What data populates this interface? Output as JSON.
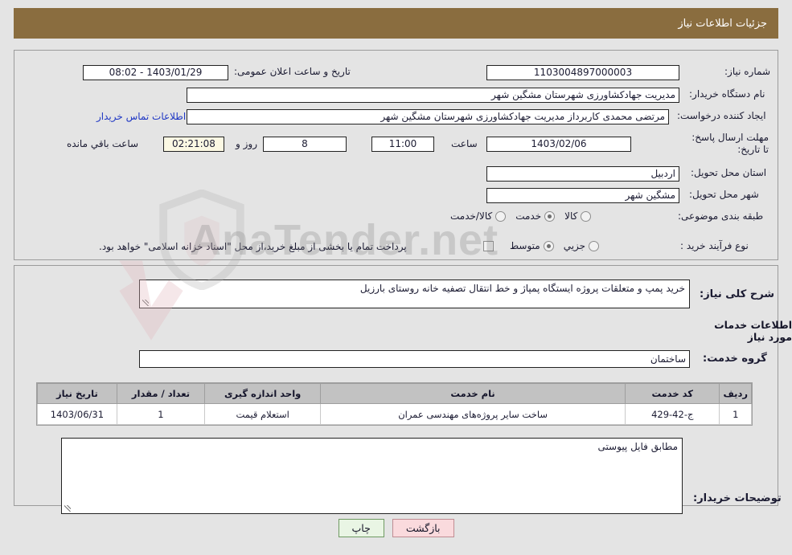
{
  "header": {
    "title": "جزئیات اطلاعات نیاز",
    "bg": "#8a6d3f"
  },
  "watermark": {
    "text": "AnaTender.net"
  },
  "top": {
    "need_number_label": "شماره نیاز:",
    "need_number_value": "1103004897000003",
    "announce_label": "تاریخ و ساعت اعلان عمومی:",
    "announce_value": "1403/01/29 - 08:02",
    "buyer_org_label": "نام دستگاه خریدار:",
    "buyer_org_value": "مدیریت جهادکشاورزی شهرستان مشگین شهر",
    "creator_label": "ایجاد کننده درخواست:",
    "creator_value": "مرتضی محمدی کاربرداز مدیریت جهادکشاورزی شهرستان مشگین شهر",
    "contact_link": "اطلاعات تماس خریدار",
    "deadline_label": "مهلت ارسال پاسخ: تا تاریخ:",
    "deadline_date": "1403/02/06",
    "deadline_hour_label": "ساعت",
    "deadline_hour": "11:00",
    "days_remaining": "8",
    "days_label": "روز و",
    "time_remaining": "02:21:08",
    "remaining_suffix": "ساعت باقي مانده",
    "province_label": "استان محل تحویل:",
    "province_value": "اردبیل",
    "city_label": "شهر محل تحویل:",
    "city_value": "مشگین شهر",
    "category_label": "طبقه بندی موضوعی:",
    "category_options": [
      {
        "label": "کالا",
        "selected": false
      },
      {
        "label": "خدمت",
        "selected": true
      },
      {
        "label": "کالا/خدمت",
        "selected": false
      }
    ],
    "process_label": "نوع فرآیند خرید :",
    "process_options": [
      {
        "label": "جزیي",
        "selected": false
      },
      {
        "label": "متوسط",
        "selected": true
      }
    ],
    "treasury_checkbox_label": "پرداخت تمام یا بخشی از مبلغ خرید،از محل \"اسناد خزانه اسلامی\" خواهد بود.",
    "treasury_checked": false
  },
  "mid": {
    "summary_label": "شرح کلی نیاز:",
    "summary_value": "خرید پمپ و متعلقات پروژه ایستگاه پمپاژ و خط انتقال تصفیه خانه روستای بارزیل",
    "services_info_title": "اطلاعات خدمات مورد نیاز",
    "service_group_label": "گروه خدمت:",
    "service_group_value": "ساختمان",
    "buyer_notes_label": "توضیحات خریدار:",
    "buyer_notes_value": "مطابق فایل پیوستی"
  },
  "table": {
    "columns": [
      "ردیف",
      "کد خدمت",
      "نام خدمت",
      "واحد اندازه گیری",
      "تعداد / مقدار",
      "تاریخ نیاز"
    ],
    "rows": [
      {
        "index": "1",
        "service_code": "ج-42-429",
        "service_name": "ساخت سایر پروژه‌های مهندسی عمران",
        "unit": "استعلام قیمت",
        "quantity": "1",
        "need_date": "1403/06/31"
      }
    ]
  },
  "footer": {
    "print_label": "چاپ",
    "back_label": "بازگشت"
  }
}
